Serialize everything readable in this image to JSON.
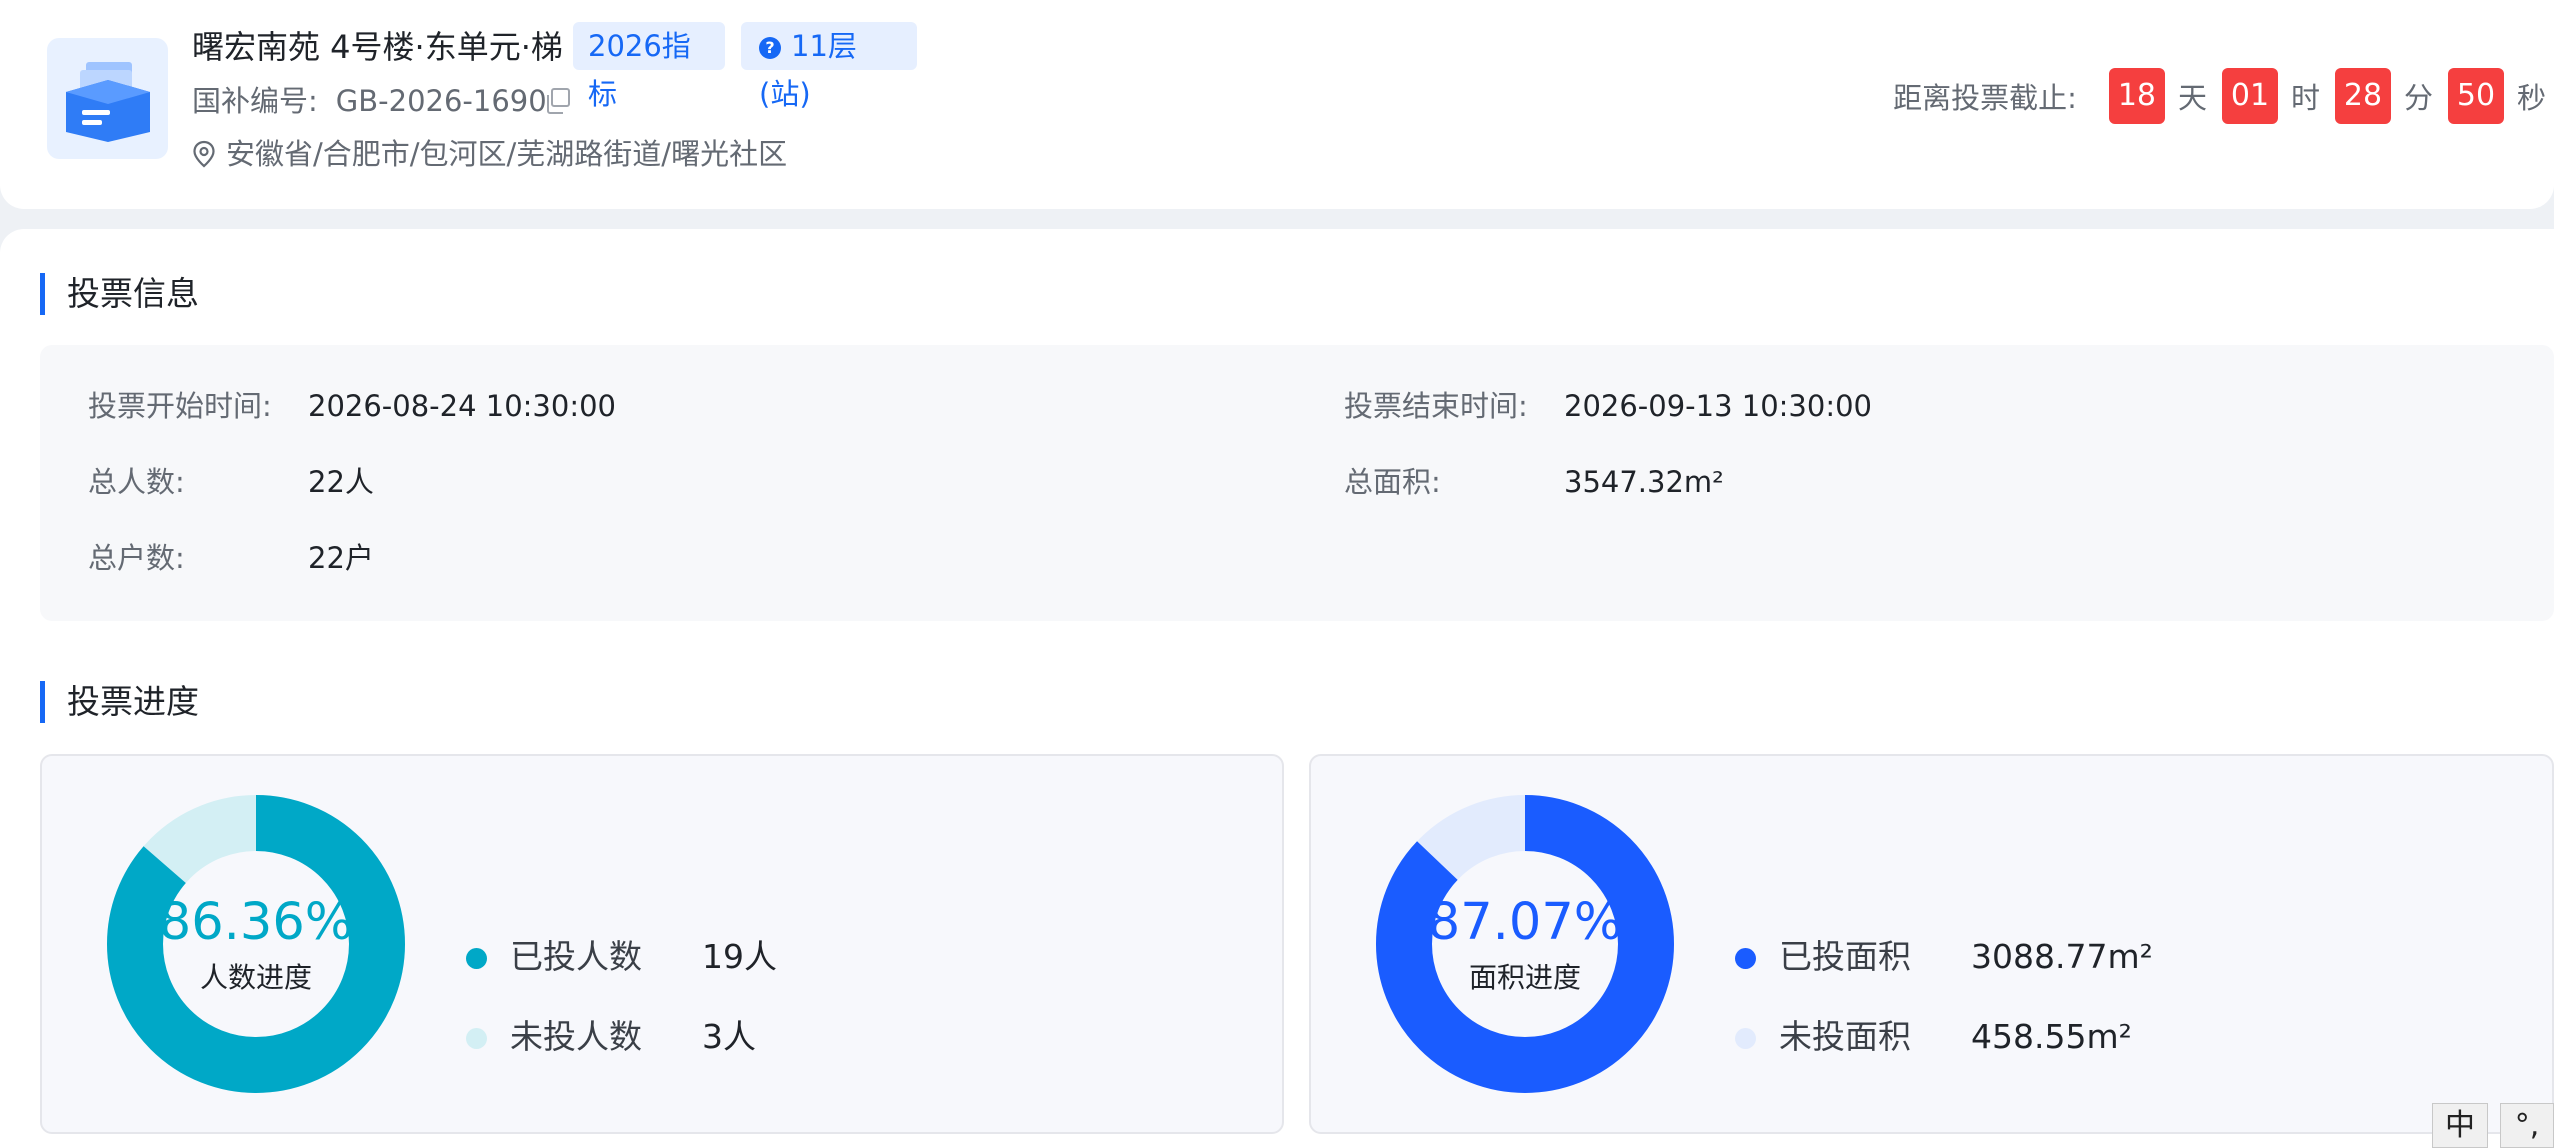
{
  "header": {
    "title": "曙宏南苑 4号楼·东单元·梯",
    "tag_year": "2026指标",
    "tag_floor": "11层(站)",
    "subsidy_label": "国补编号:",
    "subsidy_code": "GB-2026-1690",
    "address": "安徽省/合肥市/包河区/芜湖路街道/曙光社区",
    "countdown": {
      "label": "距离投票截止:",
      "days": "18",
      "days_unit": "天",
      "hours": "01",
      "hours_unit": "时",
      "minutes": "28",
      "minutes_unit": "分",
      "seconds": "50",
      "seconds_unit": "秒"
    }
  },
  "vote_info": {
    "title": "投票信息",
    "start_label": "投票开始时间:",
    "start_value": "2026-08-24 10:30:00",
    "end_label": "投票结束时间:",
    "end_value": "2026-09-13 10:30:00",
    "people_label": "总人数:",
    "people_value": "22人",
    "area_label": "总面积:",
    "area_value": "3547.32m²",
    "households_label": "总户数:",
    "households_value": "22户"
  },
  "vote_progress": {
    "title": "投票进度",
    "people": {
      "percent": "86.36%",
      "fraction": 0.8636,
      "caption": "人数进度",
      "voted_label": "已投人数",
      "voted_value": "19人",
      "unvoted_label": "未投人数",
      "unvoted_value": "3人",
      "color": "#00a8c7",
      "track_color": "#d3eff4"
    },
    "area": {
      "percent": "87.07%",
      "fraction": 0.8707,
      "caption": "面积进度",
      "voted_label": "已投面积",
      "voted_value": "3088.77m²",
      "unvoted_label": "未投面积",
      "unvoted_value": "458.55m²",
      "color": "#1a5cff",
      "track_color": "#e2ebfd"
    }
  },
  "ime": {
    "mode": "中",
    "punct": "°,"
  },
  "colors": {
    "accent": "#1668f5",
    "danger": "#f53f3f"
  }
}
